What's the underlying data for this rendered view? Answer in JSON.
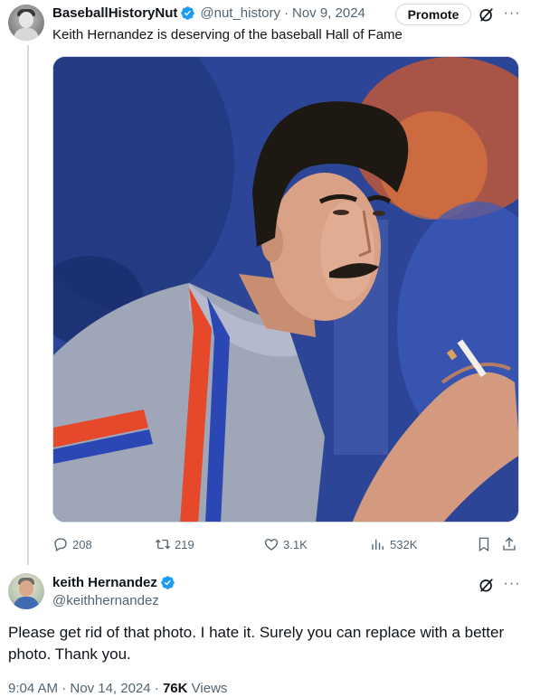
{
  "tweet": {
    "author_name": "BaseballHistoryNut",
    "author_handle": "@nut_history",
    "separator": "·",
    "date": "Nov 9, 2024",
    "promote_label": "Promote",
    "text": "Keith Hernandez is deserving of the baseball Hall of Fame",
    "actions": {
      "replies": "208",
      "retweets": "219",
      "likes": "3.1K",
      "views": "532K"
    }
  },
  "reply": {
    "author_name": "keith Hernandez",
    "author_handle": "@keithhernandez",
    "text": "Please get rid of that photo.  I hate it.  Surely you can replace with a better photo. Thank you.",
    "time": "9:04 AM",
    "separator": "·",
    "date": "Nov 14, 2024",
    "views_count": "76K",
    "views_label": "Views"
  },
  "icons": {
    "verified": "verified-badge-icon",
    "grok": "grok-icon",
    "more": "more-icon",
    "reply": "reply-icon",
    "retweet": "retweet-icon",
    "like": "heart-icon",
    "views": "views-icon",
    "bookmark": "bookmark-icon",
    "share": "share-icon"
  },
  "colors": {
    "accent": "#1d9bf0",
    "text_primary": "#0f1419",
    "text_secondary": "#536471",
    "border": "#cfd9de"
  }
}
